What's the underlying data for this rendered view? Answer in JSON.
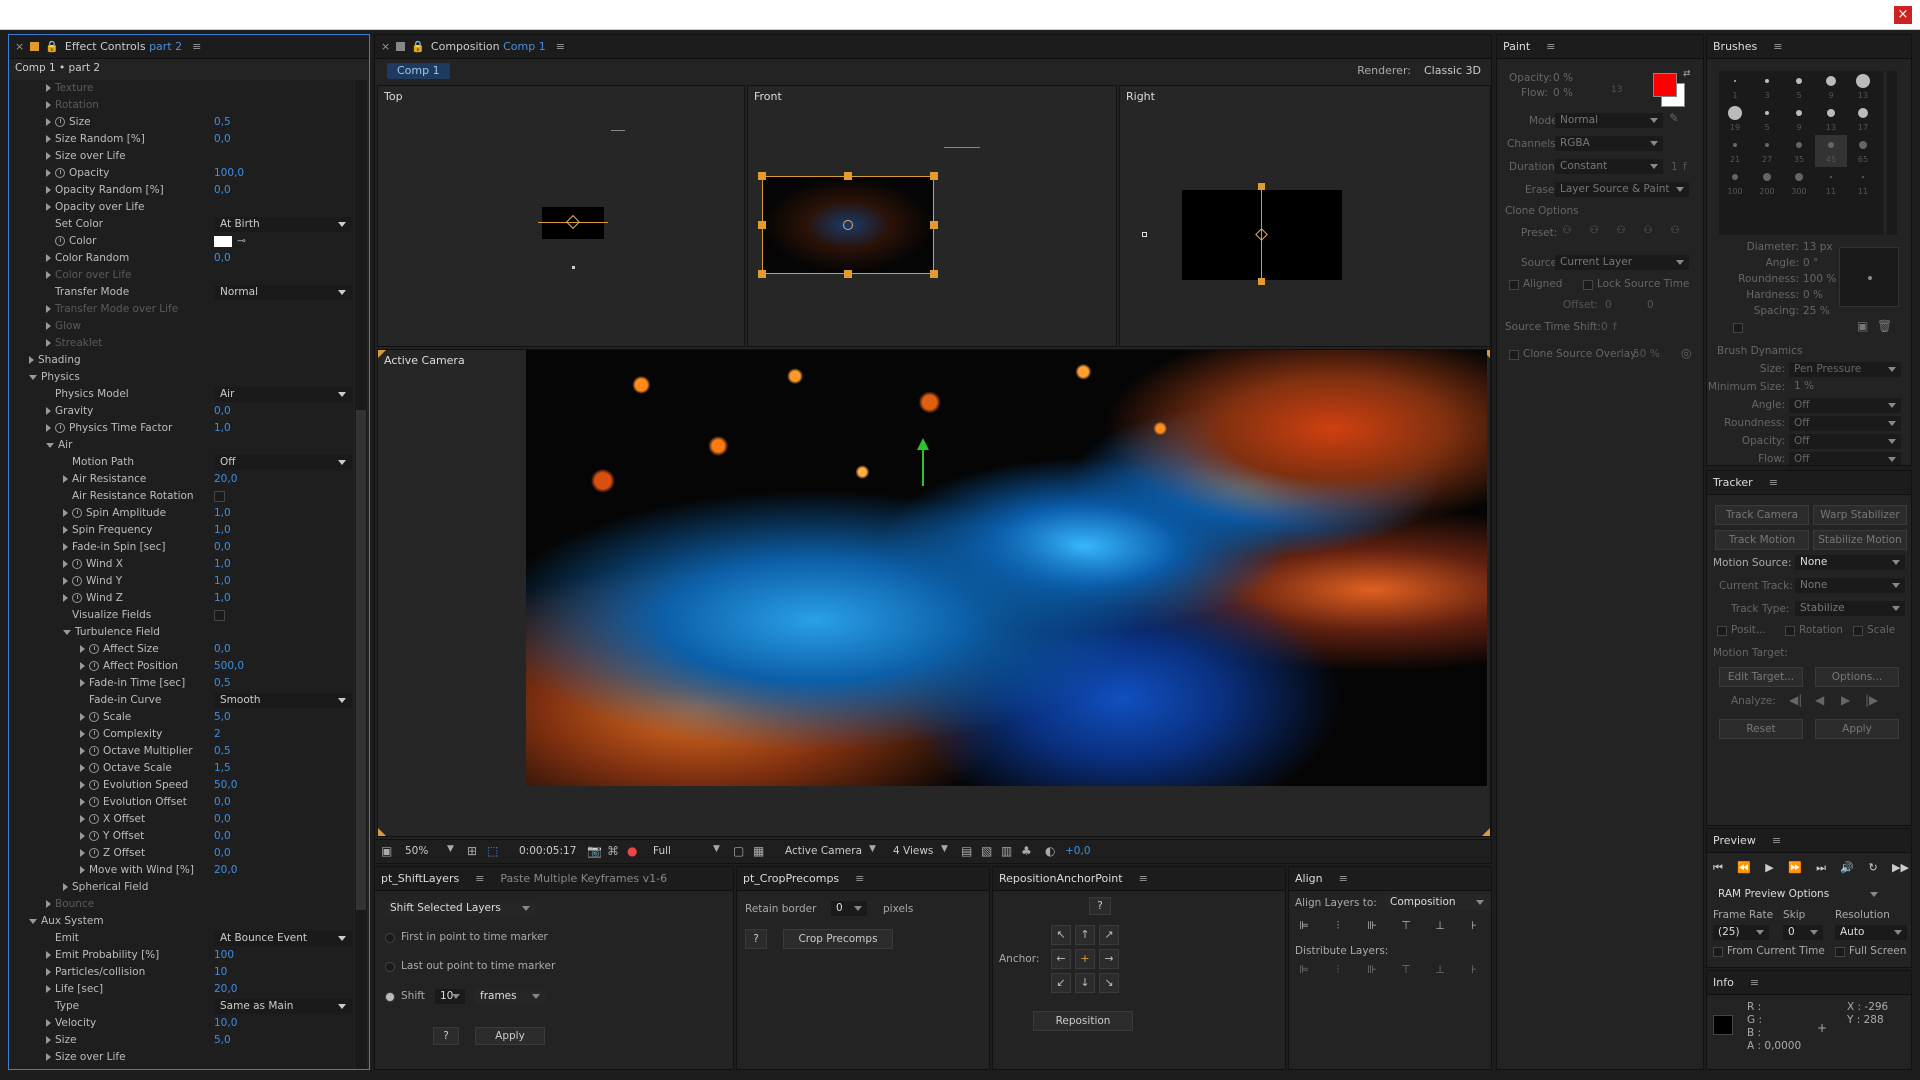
{
  "window": {
    "close": "×"
  },
  "effect_controls": {
    "tab_label": "Effect Controls",
    "tab_sub": "part 2",
    "breadcrumb": "Comp 1 • part 2",
    "rows": [
      {
        "indent": 1,
        "tri": "closed",
        "sw": false,
        "label": "Texture",
        "dim": true
      },
      {
        "indent": 1,
        "tri": "closed",
        "sw": false,
        "label": "Rotation",
        "dim": true
      },
      {
        "indent": 1,
        "tri": "closed",
        "sw": true,
        "label": "Size",
        "value": "0,5"
      },
      {
        "indent": 1,
        "tri": "closed",
        "sw": false,
        "label": "Size Random [%]",
        "value": "0,0"
      },
      {
        "indent": 1,
        "tri": "closed",
        "sw": false,
        "label": "Size over Life"
      },
      {
        "indent": 1,
        "tri": "closed",
        "sw": true,
        "label": "Opacity",
        "value": "100,0"
      },
      {
        "indent": 1,
        "tri": "closed",
        "sw": false,
        "label": "Opacity Random [%]",
        "value": "0,0"
      },
      {
        "indent": 1,
        "tri": "closed",
        "sw": false,
        "label": "Opacity over Life"
      },
      {
        "indent": 1,
        "tri": "none",
        "sw": false,
        "label": "Set Color",
        "dropdown": "At Birth"
      },
      {
        "indent": 1,
        "tri": "none",
        "sw": true,
        "label": "Color",
        "color": true
      },
      {
        "indent": 1,
        "tri": "closed",
        "sw": false,
        "label": "Color Random",
        "value": "0,0"
      },
      {
        "indent": 1,
        "tri": "closed",
        "sw": false,
        "label": "Color over Life",
        "dim": true
      },
      {
        "indent": 1,
        "tri": "none",
        "sw": false,
        "label": "Transfer Mode",
        "dropdown": "Normal"
      },
      {
        "indent": 1,
        "tri": "closed",
        "sw": false,
        "label": "Transfer Mode over Life",
        "dim": true
      },
      {
        "indent": 1,
        "tri": "closed",
        "sw": false,
        "label": "Glow",
        "dim": true
      },
      {
        "indent": 1,
        "tri": "closed",
        "sw": false,
        "label": "Streaklet",
        "dim": true
      },
      {
        "indent": 0,
        "tri": "closed",
        "sw": false,
        "label": "Shading"
      },
      {
        "indent": 0,
        "tri": "open",
        "sw": false,
        "label": "Physics"
      },
      {
        "indent": 1,
        "tri": "none",
        "sw": false,
        "label": "Physics Model",
        "dropdown": "Air"
      },
      {
        "indent": 1,
        "tri": "closed",
        "sw": false,
        "label": "Gravity",
        "value": "0,0"
      },
      {
        "indent": 1,
        "tri": "closed",
        "sw": true,
        "label": "Physics Time Factor",
        "value": "1,0"
      },
      {
        "indent": 1,
        "tri": "open",
        "sw": false,
        "label": "Air"
      },
      {
        "indent": 2,
        "tri": "none",
        "sw": false,
        "label": "Motion Path",
        "dropdown": "Off"
      },
      {
        "indent": 2,
        "tri": "closed",
        "sw": false,
        "label": "Air Resistance",
        "value": "20,0"
      },
      {
        "indent": 2,
        "tri": "none",
        "sw": false,
        "label": "Air Resistance Rotation",
        "check": true
      },
      {
        "indent": 2,
        "tri": "closed",
        "sw": true,
        "label": "Spin Amplitude",
        "value": "1,0"
      },
      {
        "indent": 2,
        "tri": "closed",
        "sw": false,
        "label": "Spin Frequency",
        "value": "1,0"
      },
      {
        "indent": 2,
        "tri": "closed",
        "sw": false,
        "label": "Fade-in Spin [sec]",
        "value": "0,0"
      },
      {
        "indent": 2,
        "tri": "closed",
        "sw": true,
        "label": "Wind X",
        "value": "1,0"
      },
      {
        "indent": 2,
        "tri": "closed",
        "sw": true,
        "label": "Wind Y",
        "value": "1,0"
      },
      {
        "indent": 2,
        "tri": "closed",
        "sw": true,
        "label": "Wind Z",
        "value": "1,0"
      },
      {
        "indent": 2,
        "tri": "none",
        "sw": false,
        "label": "Visualize Fields",
        "check": true
      },
      {
        "indent": 2,
        "tri": "open",
        "sw": false,
        "label": "Turbulence Field"
      },
      {
        "indent": 3,
        "tri": "closed",
        "sw": true,
        "label": "Affect Size",
        "value": "0,0"
      },
      {
        "indent": 3,
        "tri": "closed",
        "sw": true,
        "label": "Affect Position",
        "value": "500,0"
      },
      {
        "indent": 3,
        "tri": "closed",
        "sw": false,
        "label": "Fade-in Time [sec]",
        "value": "0,5"
      },
      {
        "indent": 3,
        "tri": "none",
        "sw": false,
        "label": "Fade-in Curve",
        "dropdown": "Smooth"
      },
      {
        "indent": 3,
        "tri": "closed",
        "sw": true,
        "label": "Scale",
        "value": "5,0"
      },
      {
        "indent": 3,
        "tri": "closed",
        "sw": true,
        "label": "Complexity",
        "value": "2"
      },
      {
        "indent": 3,
        "tri": "closed",
        "sw": true,
        "label": "Octave Multiplier",
        "value": "0,5"
      },
      {
        "indent": 3,
        "tri": "closed",
        "sw": true,
        "label": "Octave Scale",
        "value": "1,5"
      },
      {
        "indent": 3,
        "tri": "closed",
        "sw": true,
        "label": "Evolution Speed",
        "value": "50,0"
      },
      {
        "indent": 3,
        "tri": "closed",
        "sw": true,
        "label": "Evolution Offset",
        "value": "0,0"
      },
      {
        "indent": 3,
        "tri": "closed",
        "sw": true,
        "label": "X Offset",
        "value": "0,0"
      },
      {
        "indent": 3,
        "tri": "closed",
        "sw": true,
        "label": "Y Offset",
        "value": "0,0"
      },
      {
        "indent": 3,
        "tri": "closed",
        "sw": true,
        "label": "Z Offset",
        "value": "0,0"
      },
      {
        "indent": 3,
        "tri": "closed",
        "sw": false,
        "label": "Move with Wind [%]",
        "value": "20,0"
      },
      {
        "indent": 2,
        "tri": "closed",
        "sw": false,
        "label": "Spherical Field"
      },
      {
        "indent": 1,
        "tri": "closed",
        "sw": false,
        "label": "Bounce",
        "dim": true
      },
      {
        "indent": 0,
        "tri": "open",
        "sw": false,
        "label": "Aux System"
      },
      {
        "indent": 1,
        "tri": "none",
        "sw": false,
        "label": "Emit",
        "dropdown": "At Bounce Event"
      },
      {
        "indent": 1,
        "tri": "closed",
        "sw": false,
        "label": "Emit Probability [%]",
        "value": "100"
      },
      {
        "indent": 1,
        "tri": "closed",
        "sw": false,
        "label": "Particles/collision",
        "value": "10"
      },
      {
        "indent": 1,
        "tri": "closed",
        "sw": false,
        "label": "Life [sec]",
        "value": "20,0"
      },
      {
        "indent": 1,
        "tri": "none",
        "sw": false,
        "label": "Type",
        "dropdown": "Same as Main"
      },
      {
        "indent": 1,
        "tri": "closed",
        "sw": false,
        "label": "Velocity",
        "value": "10,0"
      },
      {
        "indent": 1,
        "tri": "closed",
        "sw": false,
        "label": "Size",
        "value": "5,0"
      },
      {
        "indent": 1,
        "tri": "closed",
        "sw": false,
        "label": "Size over Life"
      }
    ]
  },
  "composition": {
    "tab_label": "Composition",
    "tab_sub": "Comp 1",
    "comp_tab": "Comp 1",
    "renderer_label": "Renderer:",
    "renderer_value": "Classic 3D",
    "views": {
      "top": "Top",
      "front": "Front",
      "right": "Right",
      "active": "Active Camera"
    },
    "footer": {
      "zoom": "50%",
      "timecode": "0:00:05:17",
      "resolution": "Full",
      "camera": "Active Camera",
      "views": "4 Views",
      "exposure": "+0,0"
    }
  },
  "shiftlayers": {
    "tab": "pt_ShiftLayers",
    "tab2": "Paste Multiple Keyframes v1-6",
    "mode": "Shift Selected Layers",
    "opt1": "First in point to time marker",
    "opt2": "Last out point to time marker",
    "shift_label": "Shift",
    "shift_value": "10",
    "unit": "frames",
    "help": "?",
    "apply": "Apply"
  },
  "croprecomps": {
    "tab": "pt_CropPrecomps",
    "retain": "Retain border",
    "retain_value": "0",
    "pixels": "pixels",
    "help": "?",
    "crop": "Crop Precomps"
  },
  "repositionanchor": {
    "tab": "RepositionAnchorPoint",
    "help": "?",
    "anchor": "Anchor:",
    "reposition": "Reposition"
  },
  "align": {
    "tab": "Align",
    "align_to": "Align Layers to:",
    "align_value": "Composition",
    "distribute": "Distribute Layers:"
  },
  "paint": {
    "tab": "Paint",
    "opacity": "Opacity:",
    "opacity_value": "0 %",
    "flow": "Flow:",
    "flow_value": "0 %",
    "brush_size": "13",
    "mode": "Mode:",
    "mode_value": "Normal",
    "channels": "Channels:",
    "channels_value": "RGBA",
    "duration": "Duration:",
    "duration_value": "Constant",
    "duration_f": "1",
    "duration_unit": "f",
    "erase": "Erase:",
    "erase_value": "Layer Source & Paint",
    "clone_options": "Clone Options",
    "preset": "Preset:",
    "source": "Source:",
    "source_value": "Current Layer",
    "aligned": "Aligned",
    "lock_source": "Lock Source Time",
    "offset": "Offset:",
    "offset_x": "0",
    "offset_y": "0",
    "source_time_shift": "Source Time Shift:",
    "source_time_value": "0",
    "source_time_unit": "f",
    "clone_overlay": "Clone Source Overlay:",
    "clone_overlay_value": "50 %",
    "fg_color": "#ff0000",
    "bg_color": "#ffffff"
  },
  "brushes": {
    "tab": "Brushes",
    "sizes": [
      "1",
      "3",
      "5",
      "9",
      "13",
      "19",
      "5",
      "9",
      "13",
      "17",
      "21",
      "27",
      "35",
      "45",
      "65",
      "100",
      "200",
      "300",
      "11",
      "11"
    ],
    "diameter": "Diameter:",
    "diameter_value": "13 px",
    "angle": "Angle:",
    "angle_value": "0 °",
    "roundness": "Roundness:",
    "roundness_value": "100 %",
    "hardness": "Hardness:",
    "hardness_value": "0 %",
    "spacing": "Spacing:",
    "spacing_value": "25 %",
    "dynamics": "Brush Dynamics",
    "dyn": [
      {
        "label": "Size:",
        "value": "Pen Pressure"
      },
      {
        "label": "Minimum Size:",
        "value": "1 %",
        "plain": true
      },
      {
        "label": "Angle:",
        "value": "Off"
      },
      {
        "label": "Roundness:",
        "value": "Off"
      },
      {
        "label": "Opacity:",
        "value": "Off"
      },
      {
        "label": "Flow:",
        "value": "Off"
      }
    ]
  },
  "tracker": {
    "tab": "Tracker",
    "track_camera": "Track Camera",
    "warp_stabilizer": "Warp Stabilizer",
    "track_motion": "Track Motion",
    "stabilize_motion": "Stabilize Motion",
    "motion_source": "Motion Source:",
    "motion_source_value": "None",
    "current_track": "Current Track:",
    "current_track_value": "None",
    "track_type": "Track Type:",
    "track_type_value": "Stabilize",
    "position": "Posit...",
    "rotation": "Rotation",
    "scale": "Scale",
    "motion_target": "Motion Target:",
    "edit_target": "Edit Target...",
    "options": "Options...",
    "analyze": "Analyze:",
    "reset": "Reset",
    "apply": "Apply"
  },
  "preview": {
    "tab": "Preview",
    "ram_options": "RAM Preview Options",
    "frame_rate": "Frame Rate",
    "skip": "Skip",
    "resolution": "Resolution",
    "frame_rate_value": "(25)",
    "skip_value": "0",
    "resolution_value": "Auto",
    "from_current": "From Current Time",
    "full_screen": "Full Screen"
  },
  "info": {
    "tab": "Info",
    "r": "R :",
    "g": "G :",
    "b": "B :",
    "a": "A : 0,0000",
    "x": "X : -296",
    "y": "Y : 288"
  }
}
